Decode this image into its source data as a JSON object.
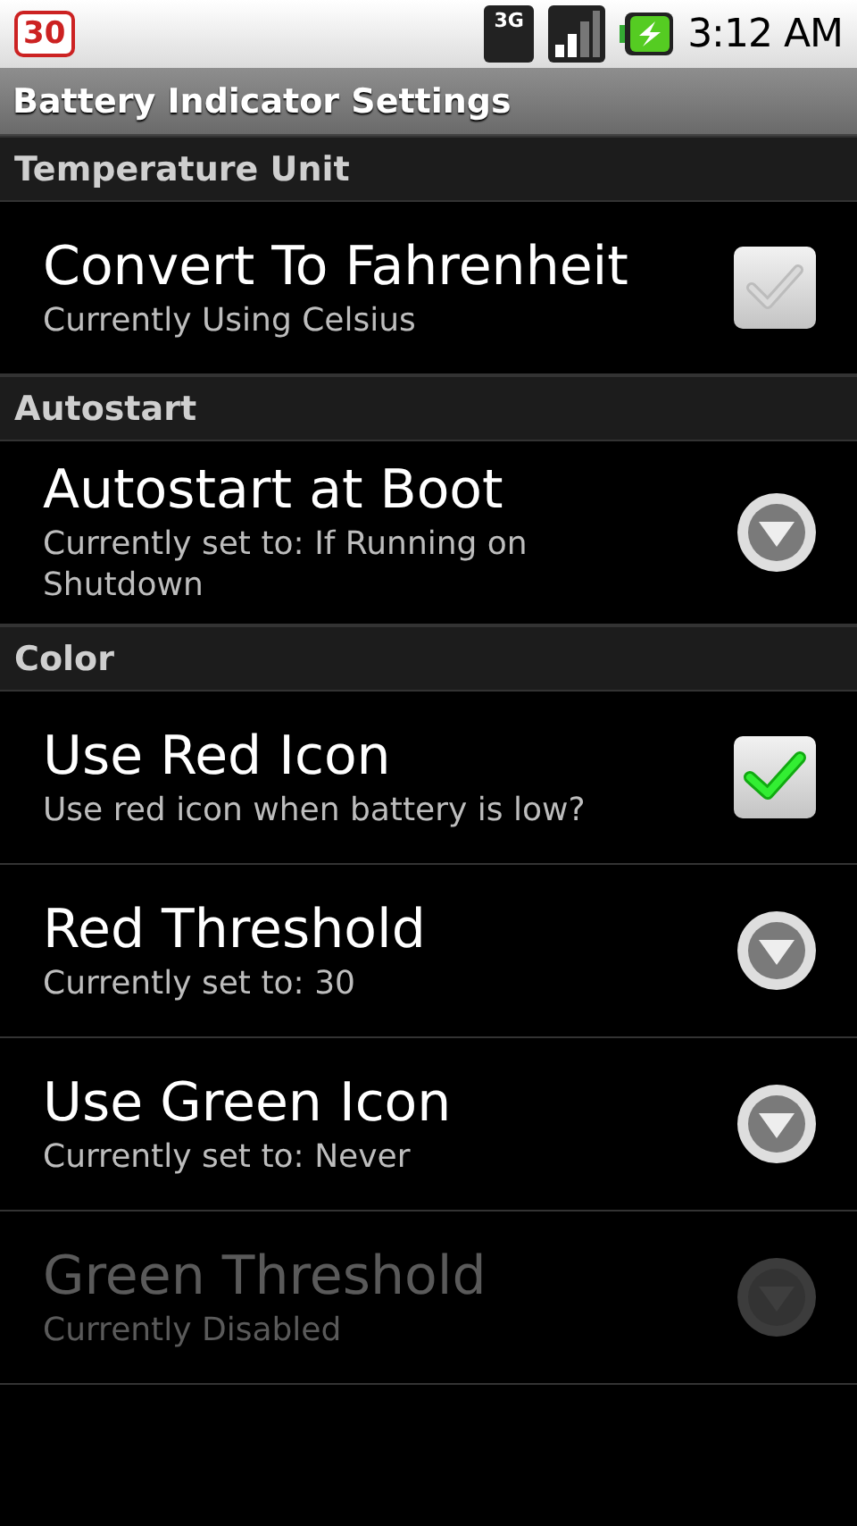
{
  "status_bar": {
    "battery_level_badge": "30",
    "network_type": "3G",
    "time": "3:12 AM"
  },
  "title": "Battery Indicator Settings",
  "sections": [
    {
      "header": "Temperature Unit",
      "items": [
        {
          "kind": "checkbox",
          "title": "Convert To Fahrenheit",
          "summary": "Currently Using Celsius",
          "checked": false,
          "disabled": false
        }
      ]
    },
    {
      "header": "Autostart",
      "items": [
        {
          "kind": "list",
          "title": "Autostart at Boot",
          "summary": "Currently set to: If Running on Shutdown",
          "disabled": false
        }
      ]
    },
    {
      "header": "Color",
      "items": [
        {
          "kind": "checkbox",
          "title": "Use Red Icon",
          "summary": "Use red icon when battery is low?",
          "checked": true,
          "disabled": false
        },
        {
          "kind": "list",
          "title": "Red Threshold",
          "summary": "Currently set to: 30",
          "disabled": false
        },
        {
          "kind": "list",
          "title": "Use Green Icon",
          "summary": "Currently set to: Never",
          "disabled": false
        },
        {
          "kind": "list",
          "title": "Green Threshold",
          "summary": "Currently Disabled",
          "disabled": true
        }
      ]
    }
  ]
}
